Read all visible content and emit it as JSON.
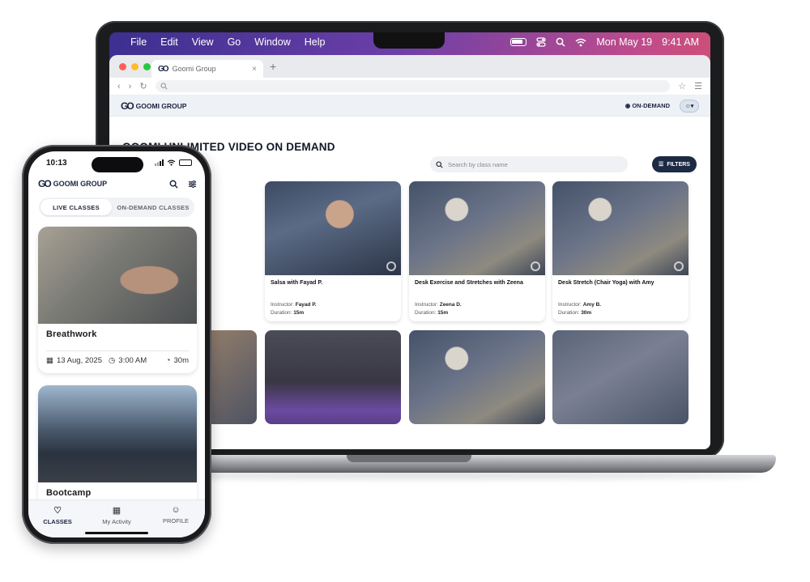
{
  "mac": {
    "menus": [
      "File",
      "Edit",
      "View",
      "Go",
      "Window",
      "Help"
    ],
    "date": "Mon May 19",
    "time": "9:41 AM"
  },
  "browser": {
    "tab_title": "Goomi Group",
    "tab_close": "×",
    "new_tab": "+"
  },
  "site": {
    "logo_mark": "GO",
    "logo_text": "GOOMI GROUP",
    "nav_on_demand": "ON-DEMAND",
    "page_title": "GOOMI UNLIMITED VIDEO ON DEMAND",
    "search_placeholder": "Search by class name",
    "filters_label": "FILTERS",
    "instructor_label": "Instructor:",
    "duration_label": "Duration:",
    "cards": [
      {
        "title": "Salsa with Fayad P.",
        "instructor": "Fayad P.",
        "duration": "15m"
      },
      {
        "title": "Desk Exercise and Stretches with Zeena",
        "instructor": "Zeena D.",
        "duration": "15m"
      },
      {
        "title": "Desk Stretch (Chair Yoga) with Amy",
        "instructor": "Amy B.",
        "duration": "30m"
      }
    ]
  },
  "phone": {
    "time": "10:13",
    "logo_mark": "GO",
    "logo_text": "GOOMI GROUP",
    "seg_live": "LIVE CLASSES",
    "seg_ondemand": "ON-DEMAND CLASSES",
    "cards": [
      {
        "title": "Breathwork",
        "date": "13 Aug, 2025",
        "time": "3:00 AM",
        "duration": "30m"
      },
      {
        "title": "Bootcamp"
      }
    ],
    "tabs": {
      "classes": "CLASSES",
      "activity": "My Activity",
      "profile": "PROFILE"
    }
  }
}
